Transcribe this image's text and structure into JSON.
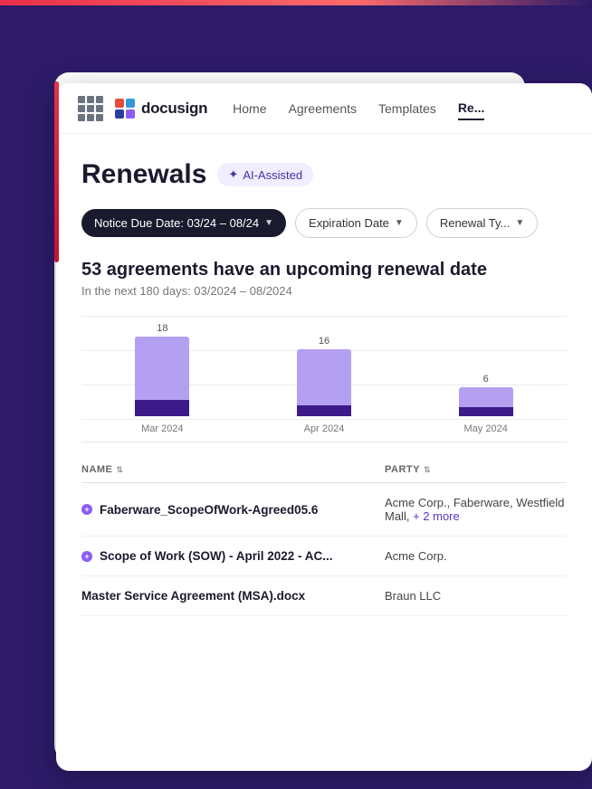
{
  "background": {
    "color": "#2d1b69"
  },
  "nav": {
    "grid_icon_label": "apps-menu",
    "logo_text": "docusign",
    "links": [
      {
        "label": "Home",
        "active": false
      },
      {
        "label": "Agreements",
        "active": false
      },
      {
        "label": "Templates",
        "active": false
      },
      {
        "label": "Re...",
        "active": true
      }
    ]
  },
  "page": {
    "title": "Renewals",
    "ai_badge": "AI-Assisted",
    "filters": [
      {
        "label": "Notice Due Date: 03/24 – 08/24",
        "style": "dark"
      },
      {
        "label": "Expiration Date",
        "style": "light"
      },
      {
        "label": "Renewal Ty...",
        "style": "light"
      }
    ],
    "stats_title": "53 agreements have an upcoming renewal date",
    "stats_subtitle": "In the next 180 days: 03/2024 – 08/2024",
    "chart": {
      "bars": [
        {
          "month": "Mar 2024",
          "value": 18,
          "top_height": 70,
          "bottom_height": 18
        },
        {
          "month": "Apr 2024",
          "value": 16,
          "top_height": 62,
          "bottom_height": 12
        },
        {
          "month": "May 2024",
          "value": 6,
          "top_height": 22,
          "bottom_height": 10
        }
      ]
    },
    "table": {
      "columns": [
        "NAME",
        "PARTY"
      ],
      "rows": [
        {
          "name": "Faberware_ScopeOfWork-Agreed05.6",
          "party": "Acme Corp., Faberware, Westfield Mall,",
          "party_extra": "+ 2 more",
          "has_dot": true
        },
        {
          "name": "Scope of Work (SOW) - April 2022 - AC...",
          "party": "Acme Corp.",
          "party_extra": "",
          "has_dot": true
        },
        {
          "name": "Master Service Agreement (MSA).docx",
          "party": "Braun LLC",
          "party_extra": "",
          "has_dot": false
        }
      ]
    }
  }
}
